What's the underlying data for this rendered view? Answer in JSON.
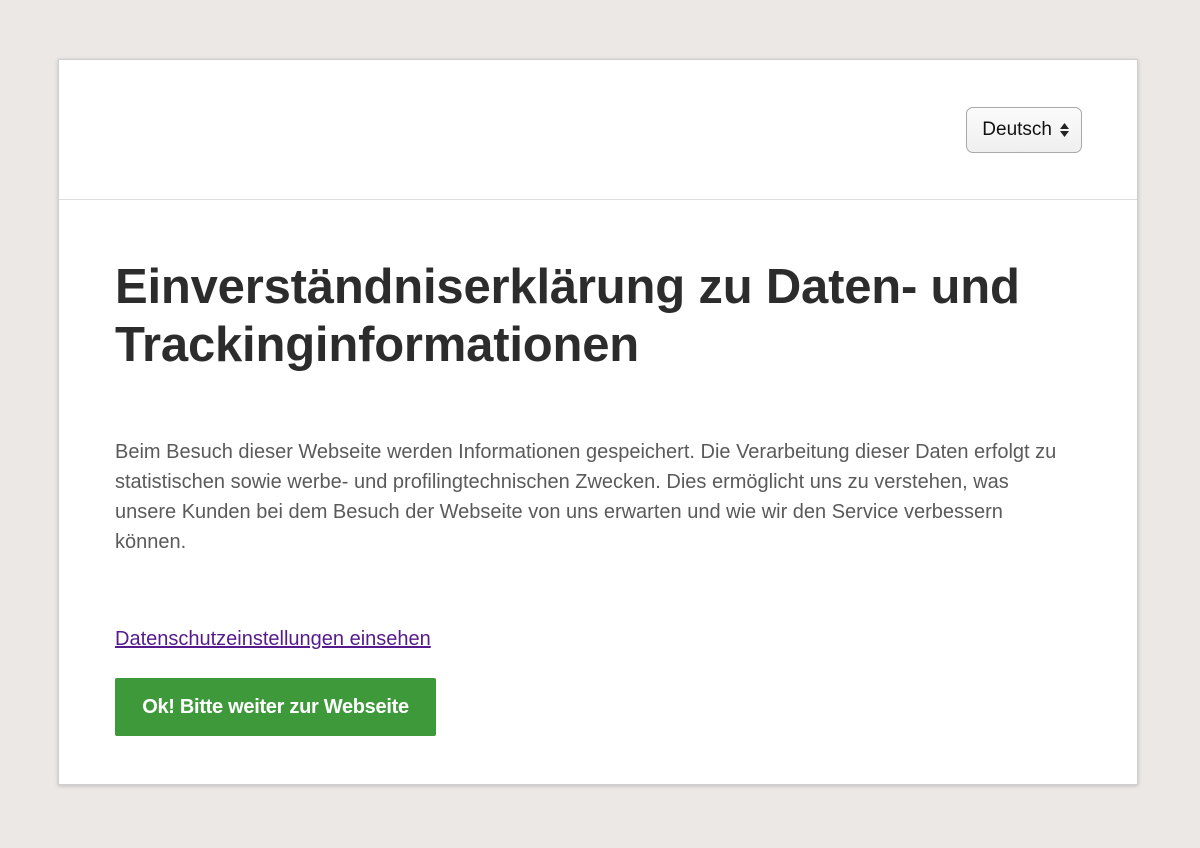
{
  "header": {
    "language_select": {
      "selected": "Deutsch"
    }
  },
  "main": {
    "title": "Einverständniserklärung zu Daten- und Trackinginformationen",
    "description": "Beim Besuch dieser Webseite werden Informationen gespeichert. Die Verarbeitung dieser Daten erfolgt zu statistischen sowie werbe- und profilingtechnischen Zwecken. Dies ermöglicht uns zu verstehen, was unsere Kunden bei dem Besuch der Webseite von uns erwarten und wie wir den Service verbessern können.",
    "privacy_link": "Datenschutzeinstellungen einsehen",
    "ok_button": "Ok! Bitte weiter zur Webseite"
  },
  "colors": {
    "page_background": "#ebe8e6",
    "button_green": "#3e993b",
    "link_visited": "#551a8b",
    "title_text": "#2c2c2c",
    "body_text": "#5a5a5a"
  },
  "icons": {
    "language_select_arrows": "updown-arrows-icon"
  }
}
